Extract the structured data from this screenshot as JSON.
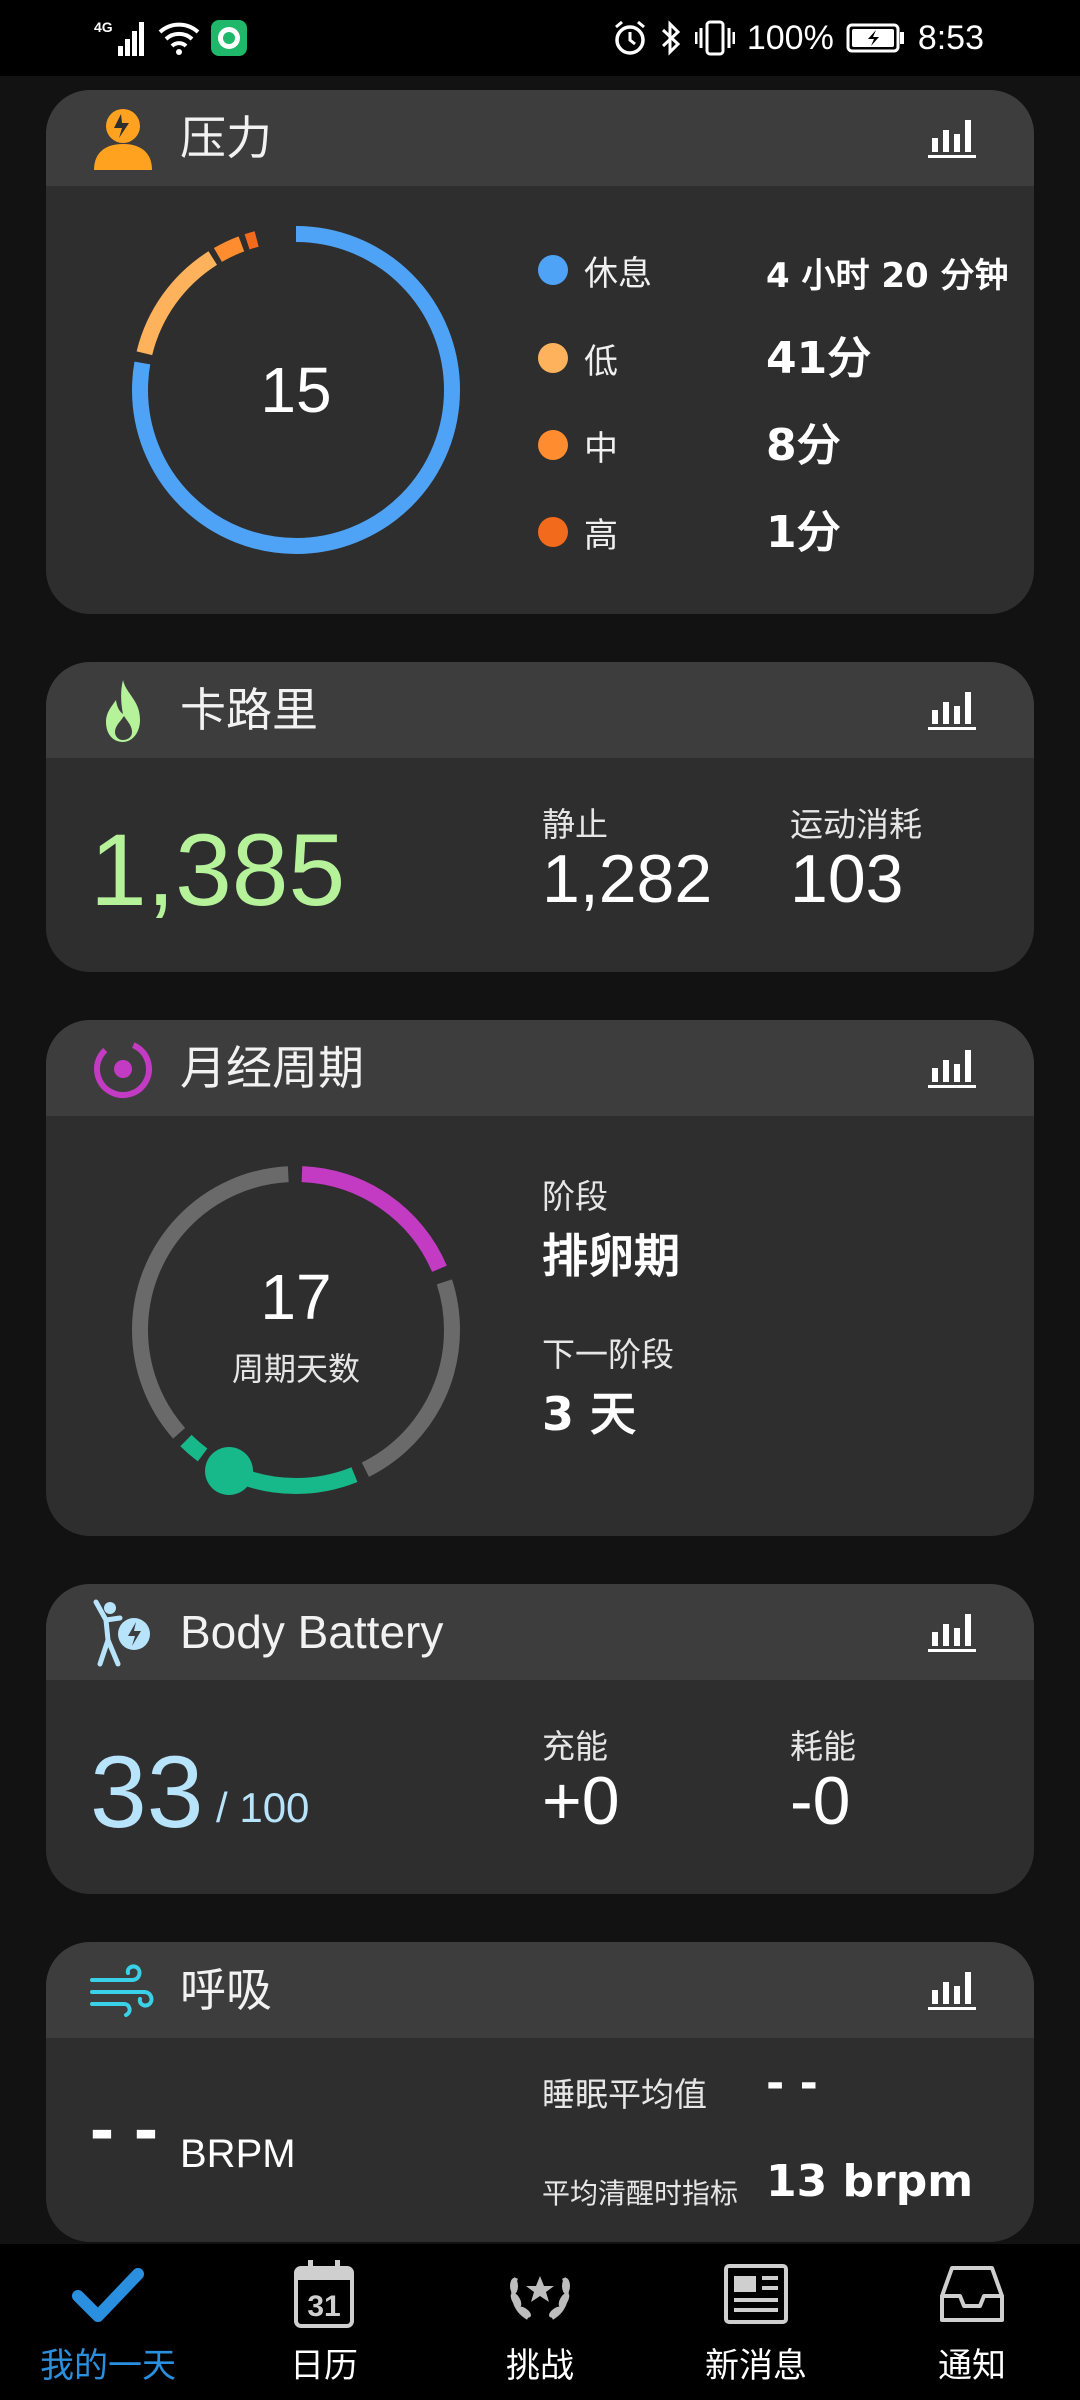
{
  "status_bar": {
    "network": "4G",
    "battery": "100%",
    "time": "8:53"
  },
  "stress": {
    "title": "压力",
    "score": "15",
    "levels": [
      {
        "label": "休息",
        "value": "4 小时 20 分钟",
        "color": "#4fa3f7"
      },
      {
        "label": "低",
        "value": "41分",
        "color": "#ffb25c"
      },
      {
        "label": "中",
        "value": "8分",
        "color": "#ff8c2e"
      },
      {
        "label": "高",
        "value": "1分",
        "color": "#f26a1b"
      }
    ]
  },
  "calories": {
    "title": "卡路里",
    "total": "1,385",
    "resting_label": "静止",
    "resting_value": "1,282",
    "active_label": "运动消耗",
    "active_value": "103",
    "accent": "#b5f29a"
  },
  "cycle": {
    "title": "月经周期",
    "day": "17",
    "day_label": "周期天数",
    "phase_label": "阶段",
    "phase_value": "排卵期",
    "next_label": "下一阶段",
    "next_value": "3 天",
    "accent": "#c23bc2",
    "fertile_color": "#17b889"
  },
  "body_battery": {
    "title": "Body Battery",
    "value": "33",
    "max": "/ 100",
    "charged_label": "充能",
    "charged_value": "+0",
    "drained_label": "耗能",
    "drained_value": "-0",
    "accent": "#b7e3fb"
  },
  "respiration": {
    "title": "呼吸",
    "value": "- -",
    "unit": "BRPM",
    "sleep_avg_label": "睡眠平均值",
    "sleep_avg_value": "- -",
    "awake_avg_label": "平均清醒时指标",
    "awake_avg_value": "13 brpm",
    "accent": "#3ad1e8"
  },
  "nav": {
    "items": [
      {
        "label": "我的一天",
        "icon": "checkmark-icon"
      },
      {
        "label": "日历",
        "icon": "calendar-icon",
        "day": "31"
      },
      {
        "label": "挑战",
        "icon": "laurel-icon"
      },
      {
        "label": "新消息",
        "icon": "newspaper-icon"
      },
      {
        "label": "通知",
        "icon": "inbox-icon"
      }
    ],
    "active_color": "#2b8fe0"
  }
}
